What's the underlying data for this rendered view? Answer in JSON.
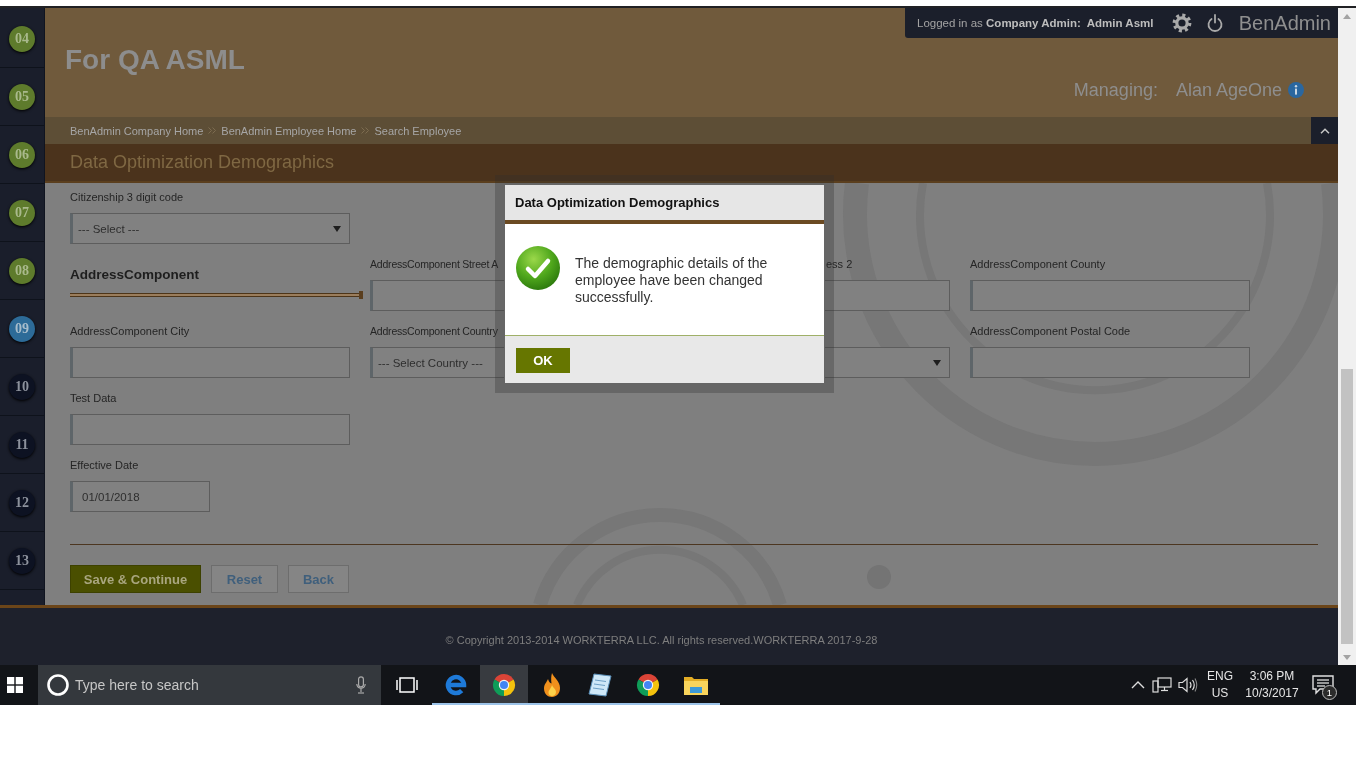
{
  "steps": [
    {
      "label": "04",
      "completed": true,
      "selected": false
    },
    {
      "label": "05",
      "completed": true,
      "selected": false
    },
    {
      "label": "06",
      "completed": true,
      "selected": false
    },
    {
      "label": "07",
      "completed": true,
      "selected": false
    },
    {
      "label": "08",
      "completed": true,
      "selected": false
    },
    {
      "label": "09",
      "completed": false,
      "selected": true
    },
    {
      "label": "10",
      "completed": false,
      "selected": false
    },
    {
      "label": "11",
      "completed": false,
      "selected": false
    },
    {
      "label": "12",
      "completed": false,
      "selected": false
    },
    {
      "label": "13",
      "completed": false,
      "selected": false
    }
  ],
  "header": {
    "user_bar": {
      "login_text": "Logged in as **Company Admin:  Admin Asml**",
      "app_name": "BenAdmin"
    },
    "title": "For QA ASML",
    "managing_label": "Managing:",
    "managing_name": "Alan AgeOne"
  },
  "breadcrumbs": [
    "BenAdmin Company Home",
    "BenAdmin Employee Home",
    "Search Employee"
  ],
  "page_title": "Data Optimization Demographics",
  "form": {
    "rows": [
      [
        {
          "kind": "select",
          "label": "Citizenship 3 digit code",
          "value": "--- Select ---"
        }
      ],
      [
        {
          "kind": "heading",
          "label": "AddressComponent"
        },
        {
          "kind": "text",
          "label": "AddressComponent Street A"
        },
        {
          "kind": "text",
          "label": "ess 2"
        },
        {
          "kind": "text",
          "label": "AddressComponent County"
        }
      ],
      [
        {
          "kind": "text",
          "label": "AddressComponent City"
        },
        {
          "kind": "select",
          "label": "AddressComponent Country",
          "value": "--- Select Country ---"
        },
        {
          "kind": "select"
        },
        {
          "kind": "text",
          "label": "AddressComponent Postal Code"
        }
      ],
      [
        {
          "kind": "text",
          "label": "Test Data"
        }
      ],
      [
        {
          "kind": "date",
          "label": "Effective Date",
          "value": "01/01/2018"
        }
      ]
    ],
    "buttons": [
      {
        "kind": "primary",
        "label": "Save & Continue"
      },
      {
        "kind": "secondary",
        "label": "Reset"
      },
      {
        "kind": "secondary",
        "label": "Back"
      }
    ]
  },
  "footer": {
    "copyright": "© Copyright 2013-2014 WORKTERRA LLC. All rights reserved.WORKTERRA 2017-9-28"
  },
  "dialog": {
    "title": "Data Optimization Demographics",
    "message": "The demographic details of the employee have been changed successfully.",
    "ok_label": "OK"
  },
  "taskbar": {
    "search": {
      "placeholder": "Type here to search"
    },
    "apps": [
      {
        "kind": "letter",
        "running": true,
        "selected": false
      },
      {
        "kind": "wheel",
        "running": true,
        "selected": true
      },
      {
        "kind": "flame",
        "running": true,
        "selected": false
      },
      {
        "kind": "notepad",
        "running": true,
        "selected": false
      },
      {
        "kind": "wheel",
        "running": true,
        "selected": false
      },
      {
        "kind": "folder",
        "running": true,
        "selected": false
      }
    ],
    "language": "ENG",
    "region": "US",
    "time": "3:06 PM",
    "date": "10/3/2017",
    "notification_count": "1"
  }
}
